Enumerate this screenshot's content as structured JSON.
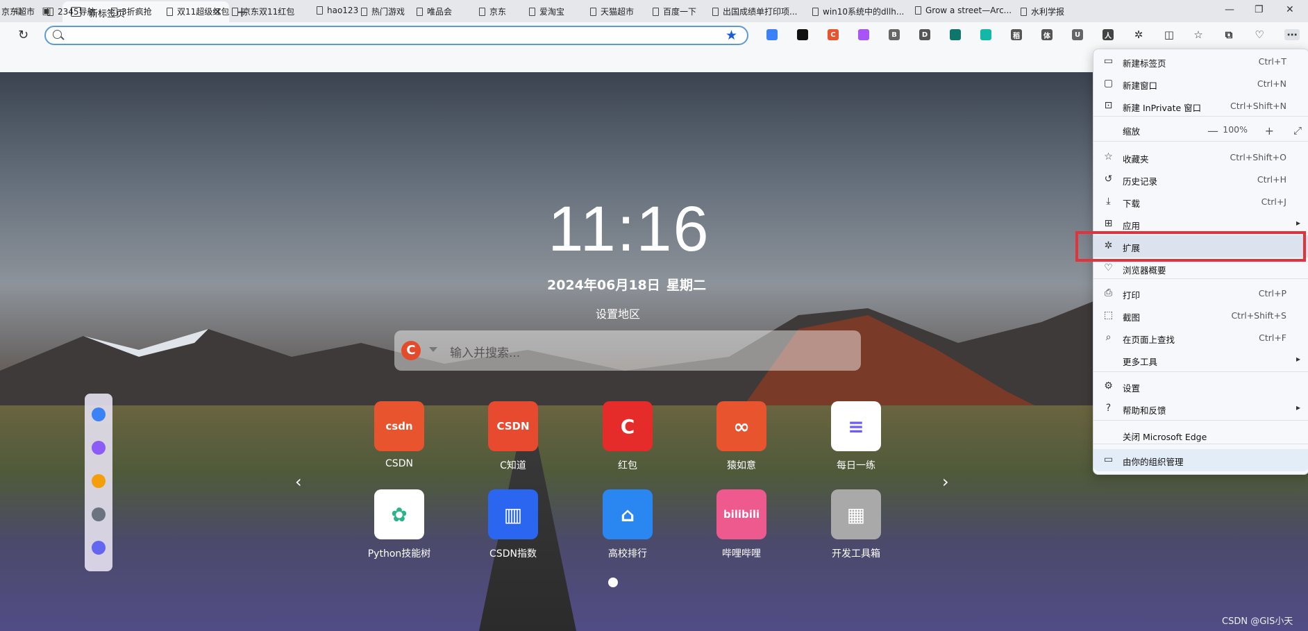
{
  "tab": {
    "title": "新标签页"
  },
  "address": {
    "value": "",
    "placeholder": ""
  },
  "bookmarks": [
    "京东超市",
    "2345导航",
    "3折疯抢",
    "双11超级红包",
    "京东双11红包",
    "hao123",
    "热门游戏",
    "唯品会",
    "京东",
    "爱淘宝",
    "天猫超市",
    "百度一下",
    "出国成绩单打印项...",
    "win10系统中的dllh...",
    "Grow a street—Arc...",
    "水利学报"
  ],
  "newtab": {
    "time": "11:16",
    "date": "2024年06月18日",
    "weekday": "星期二",
    "region_link": "设置地区",
    "search_placeholder": "输入并搜索...",
    "search_logo": "C",
    "tiles": [
      {
        "label": "CSDN",
        "icon": "csdn-icon",
        "color": "#e8542e",
        "glyph": "csdn"
      },
      {
        "label": "C知道",
        "icon": "robot-icon",
        "color": "#e84a30",
        "glyph": "CSDN"
      },
      {
        "label": "红包",
        "icon": "redpacket-icon",
        "color": "#e62b2b",
        "glyph": "C"
      },
      {
        "label": "猿如意",
        "icon": "yuanruyi-icon",
        "color": "#e8542e",
        "glyph": "∞"
      },
      {
        "label": "每日一练",
        "icon": "practice-icon",
        "color": "#ffffff",
        "glyph": "≡"
      },
      {
        "label": "Python技能树",
        "icon": "tree-icon",
        "color": "#ffffff",
        "glyph": "✿"
      },
      {
        "label": "CSDN指数",
        "icon": "chart-icon",
        "color": "#2a66f0",
        "glyph": "▥"
      },
      {
        "label": "高校排行",
        "icon": "school-icon",
        "color": "#2a86f0",
        "glyph": "⌂"
      },
      {
        "label": "哔哩哔哩",
        "icon": "bilibili-icon",
        "color": "#ee5a8d",
        "glyph": "bilibili"
      },
      {
        "label": "开发工具箱",
        "icon": "toolbox-icon",
        "color": "#a9a9a9",
        "glyph": "▦"
      }
    ],
    "watermark": "CSDN @GIS小天"
  },
  "menu": {
    "items": [
      {
        "label": "新建标签页",
        "shortcut": "Ctrl+T",
        "icon": "new-tab-icon"
      },
      {
        "label": "新建窗口",
        "shortcut": "Ctrl+N",
        "icon": "new-window-icon"
      },
      {
        "label": "新建 InPrivate 窗口",
        "shortcut": "Ctrl+Shift+N",
        "icon": "inprivate-icon"
      },
      {
        "label": "缩放",
        "zoom": "100%"
      },
      {
        "label": "收藏夹",
        "shortcut": "Ctrl+Shift+O",
        "icon": "favorites-icon"
      },
      {
        "label": "历史记录",
        "shortcut": "Ctrl+H",
        "icon": "history-icon"
      },
      {
        "label": "下载",
        "shortcut": "Ctrl+J",
        "icon": "download-icon"
      },
      {
        "label": "应用",
        "icon": "apps-icon"
      },
      {
        "label": "扩展",
        "icon": "extensions-icon"
      },
      {
        "label": "浏览器概要",
        "icon": "essentials-icon"
      },
      {
        "label": "打印",
        "shortcut": "Ctrl+P",
        "icon": "print-icon"
      },
      {
        "label": "截图",
        "shortcut": "Ctrl+Shift+S",
        "icon": "screenshot-icon"
      },
      {
        "label": "在页面上查找",
        "shortcut": "Ctrl+F",
        "icon": "find-icon"
      },
      {
        "label": "更多工具"
      },
      {
        "label": "设置",
        "icon": "settings-icon"
      },
      {
        "label": "帮助和反馈",
        "icon": "help-icon"
      },
      {
        "label": "关闭 Microsoft Edge"
      },
      {
        "label": "由你的组织管理",
        "icon": "org-icon"
      }
    ]
  },
  "extensions": [
    {
      "letter": "",
      "color": "#3b82f6"
    },
    {
      "letter": "",
      "color": "#111111"
    },
    {
      "letter": "C",
      "color": "#e8542e"
    },
    {
      "letter": "",
      "color": "#a855f7"
    },
    {
      "letter": "B",
      "color": "#666666"
    },
    {
      "letter": "D",
      "color": "#555555"
    },
    {
      "letter": "",
      "color": "#0f766e"
    },
    {
      "letter": "",
      "color": "#14b8a6"
    },
    {
      "letter": "稻",
      "color": "#555555"
    },
    {
      "letter": "体",
      "color": "#555555"
    },
    {
      "letter": "U",
      "color": "#666666"
    },
    {
      "letter": "人",
      "color": "#444444"
    }
  ]
}
